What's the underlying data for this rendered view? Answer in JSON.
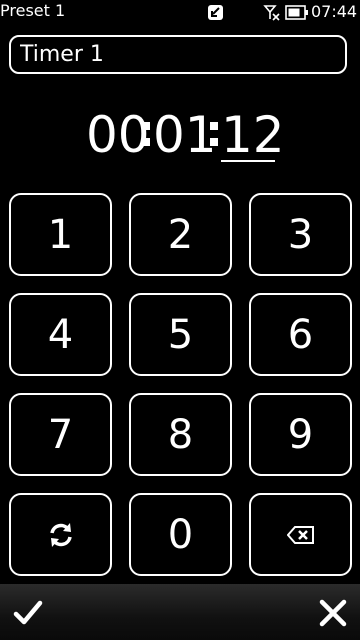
{
  "status": {
    "title": "Preset 1",
    "time": "07:44",
    "icons": [
      "notification-icon",
      "no-network-icon",
      "battery-icon"
    ]
  },
  "timer_name": {
    "value": "Timer 1"
  },
  "timer": {
    "hours": "00",
    "minutes": "01",
    "seconds": "12",
    "selected_field": "seconds"
  },
  "keypad": {
    "keys": [
      "1",
      "2",
      "3",
      "4",
      "5",
      "6",
      "7",
      "8",
      "9",
      "0"
    ],
    "icons": [
      "reset-icon",
      "backspace-icon"
    ]
  },
  "softkeys": {
    "icons": [
      "checkmark-icon",
      "close-icon"
    ]
  },
  "colors": {
    "background": "#000000",
    "foreground": "#ffffff",
    "ghost_digit": "#3a3a3a"
  }
}
